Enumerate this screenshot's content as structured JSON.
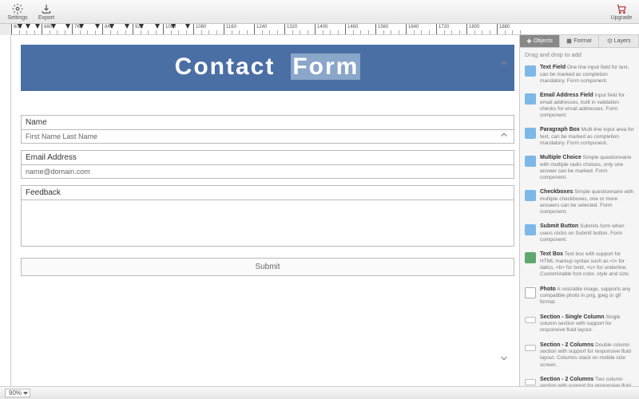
{
  "toolbar": {
    "settings": "Settings",
    "export": "Export",
    "upgrade": "Upgrade"
  },
  "ruler": {
    "marks": [
      "600",
      "680",
      "760",
      "840",
      "920",
      "1000",
      "1080",
      "1160",
      "1240",
      "1320",
      "1400",
      "1480",
      "1560",
      "1640",
      "1720",
      "1800",
      "1880"
    ]
  },
  "header": {
    "word1": "Contact",
    "word2": "Form"
  },
  "form": {
    "name_label": "Name",
    "name_placeholder": "First Name Last Name",
    "email_label": "Email Address",
    "email_placeholder": "name@domain.com",
    "feedback_label": "Feedback",
    "submit": "Submit"
  },
  "sidebar": {
    "tabs": {
      "objects": "Objects",
      "format": "Format",
      "layers": "Layers"
    },
    "dnd": "Drag and drop to add",
    "items": [
      {
        "icon": "blue",
        "title": "Text Field",
        "desc": "One line input field for text, can be marked as completion mandatory.  Form component."
      },
      {
        "icon": "blue",
        "title": "Email Address Field",
        "desc": "Input field for email addresses, built in validation checks for email addresses.  Form component."
      },
      {
        "icon": "blue",
        "title": "Paragraph Box",
        "desc": "Multi-line input area for text, can be marked as completion mandatory.  Form component."
      },
      {
        "icon": "blue",
        "title": "Multiple Choice",
        "desc": "Simple questionnaire with multiple radio choices, only one answer can be marked.  Form component."
      },
      {
        "icon": "blue",
        "title": "Checkboxes",
        "desc": "Simple questionnaire with multiple checkboxes, one or more answers can be selected.  Form component."
      },
      {
        "icon": "blue",
        "title": "Submit Button",
        "desc": "Submits form when users clicks on Submit button.  Form component."
      },
      {
        "icon": "green",
        "title": "Text Box",
        "desc": "Text box with support for HTML markup syntax such as <i> for italics, <b> for bold, <u> for underline. Customizable font color, style and size."
      },
      {
        "icon": "gray",
        "title": "Photo",
        "desc": "A resizable image, supports any compatible photo in png, jpeg or gif format."
      },
      {
        "icon": "outline",
        "title": "Section - Single Column",
        "desc": "Single column section with support for responsive fluid layout."
      },
      {
        "icon": "outline",
        "title": "Section - 2 Columns",
        "desc": "Double column section with support for responsive fluid layout.  Columns stack on mobile size screen."
      },
      {
        "icon": "outline",
        "title": "Section - 2 Columns",
        "desc": "Two column section with support for responsive fluid"
      }
    ]
  },
  "status": {
    "zoom": "90%"
  }
}
